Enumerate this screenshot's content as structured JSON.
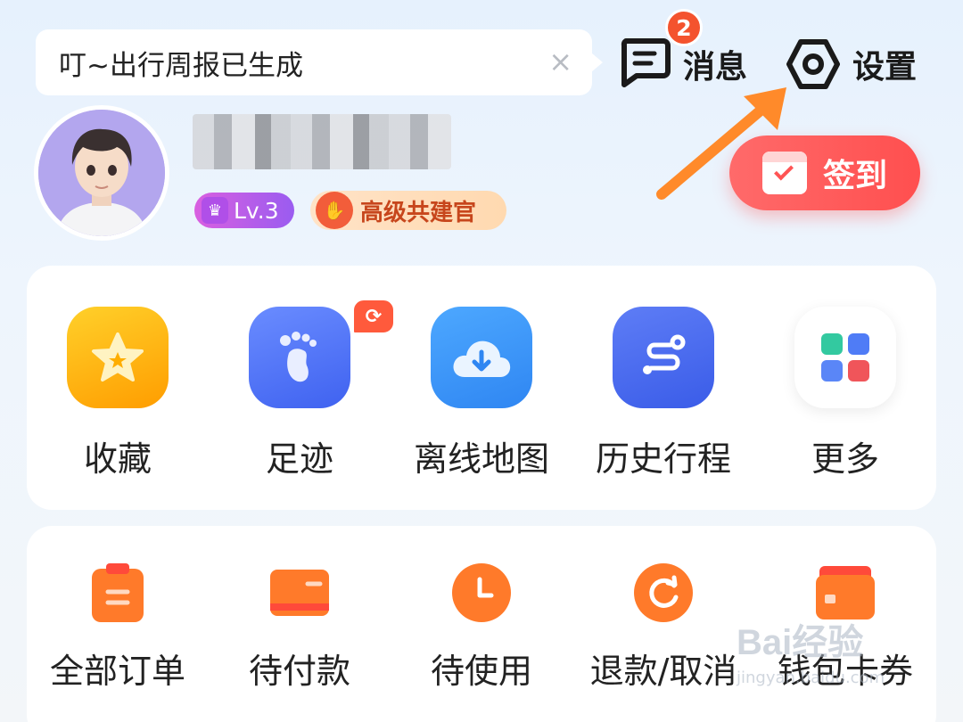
{
  "notice": {
    "text": "叮~出行周报已生成",
    "close": "×"
  },
  "header": {
    "messages": {
      "label": "消息",
      "badge": "2"
    },
    "settings": {
      "label": "设置"
    }
  },
  "profile": {
    "level": "Lv.3",
    "title_badge": "高级共建官",
    "checkin_label": "签到"
  },
  "quick_actions": [
    {
      "label": "收藏",
      "icon": "star-icon"
    },
    {
      "label": "足迹",
      "icon": "footprint-icon"
    },
    {
      "label": "离线地图",
      "icon": "cloud-download-icon"
    },
    {
      "label": "历史行程",
      "icon": "route-icon"
    },
    {
      "label": "更多",
      "icon": "grid-icon"
    }
  ],
  "orders": [
    {
      "label": "全部订单",
      "icon": "clipboard-icon"
    },
    {
      "label": "待付款",
      "icon": "card-icon"
    },
    {
      "label": "待使用",
      "icon": "clock-icon"
    },
    {
      "label": "退款/取消",
      "icon": "refund-icon"
    },
    {
      "label": "钱包卡券",
      "icon": "wallet-icon"
    }
  ],
  "watermark": {
    "main": "Bai经验",
    "sub": "jingyan.baidu.com"
  },
  "colors": {
    "accent_red": "#ff4f4f",
    "accent_orange": "#ff7a2a",
    "arrow": "#ff8a2a"
  }
}
